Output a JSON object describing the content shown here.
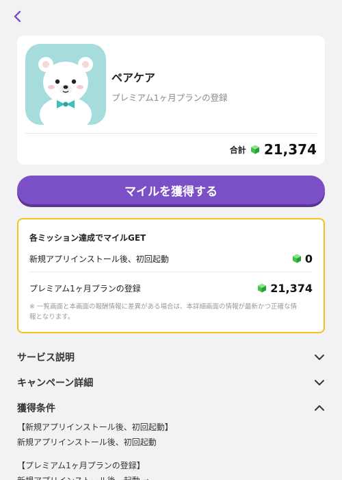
{
  "colors": {
    "accent": "#7b4fc6",
    "highlight_border": "#f4c21a",
    "gem": "#3fc24a"
  },
  "header": {
    "back_icon": "chevron-left-icon"
  },
  "app": {
    "name": "ペアケア",
    "subtitle": "プレミアム1ヶ月プランの登録",
    "total_label": "合計",
    "total_value": "21,374"
  },
  "cta": {
    "label": "マイルを獲得する"
  },
  "missions": {
    "title": "各ミッション達成でマイルGET",
    "items": [
      {
        "label": "新規アプリインストール後、初回起動",
        "value": "0"
      },
      {
        "label": "プレミアム1ヶ月プランの登録",
        "value": "21,374"
      }
    ],
    "note_line1": "※ 一覧画面と本画面の報酬情報に差異がある場合は、本詳細画面の情報が最新かつ正確な情",
    "note_line2": "報となります。"
  },
  "sections": [
    {
      "title": "サービス説明",
      "icon": "chevron-down-icon"
    },
    {
      "title": "キャンペーン詳細",
      "icon": "chevron-down-icon"
    },
    {
      "title": "獲得条件",
      "icon": "chevron-up-icon"
    }
  ],
  "conditions": {
    "line1": "【新規アプリインストール後、初回起動】",
    "line2": "新規アプリインストール後、初回起動",
    "line3": "【プレミアム1ヶ月プランの登録】",
    "line4": "新規アプリインストール後、起動 ⇒"
  }
}
